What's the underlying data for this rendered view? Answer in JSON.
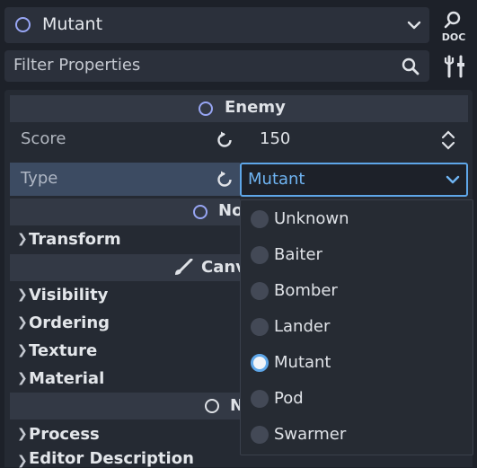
{
  "header": {
    "object_name": "Mutant",
    "doc_label": "DOC",
    "filter_placeholder": "Filter Properties"
  },
  "sections": {
    "enemy": "Enemy",
    "node_partial": "No",
    "canvas_partial": "Canv",
    "third_partial": "N"
  },
  "properties": {
    "score_label": "Score",
    "score_value": "150",
    "type_label": "Type",
    "type_value": "Mutant"
  },
  "groups": {
    "transform": "Transform",
    "visibility": "Visibility",
    "ordering": "Ordering",
    "texture": "Texture",
    "material": "Material",
    "process": "Process",
    "editor_description": "Editor Description"
  },
  "dropdown": {
    "selected": "Mutant",
    "options": [
      "Unknown",
      "Baiter",
      "Bomber",
      "Lander",
      "Mutant",
      "Pod",
      "Swarmer"
    ]
  },
  "colors": {
    "accent": "#5ea6e8",
    "node_icon": "#97a5f3",
    "background": "#1d2129"
  }
}
